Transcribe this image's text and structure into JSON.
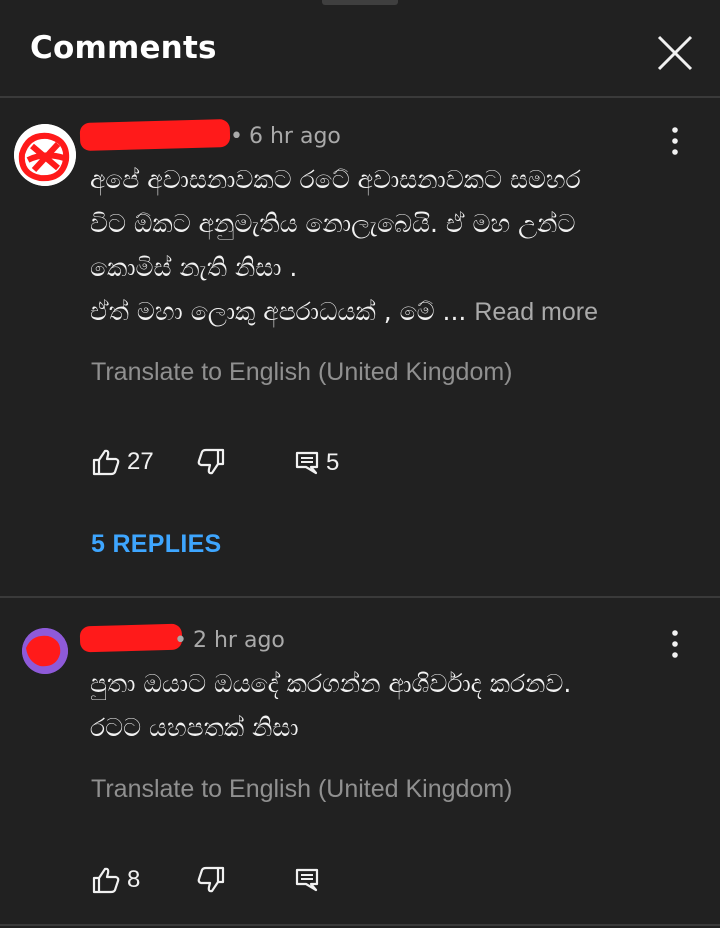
{
  "header": {
    "title": "Comments",
    "close_icon": "close-icon"
  },
  "comments": [
    {
      "time": "6 hr ago",
      "text_lines": [
        "අපේ අවාසනාවකට රටේ අවාසනාවකට සමහර",
        "විට ඕකට අනුමැතිය නොලැබෙයි. ඒ මහ උන්ට",
        "කොමිස් නැති නිසා .",
        "ඒත් මහා ලොකු අපරාධයක් , මේ ..."
      ],
      "read_more": "Read more",
      "translate": "Translate to English (United Kingdom)",
      "likes": "27",
      "reply_count": "5",
      "replies_link": "5 REPLIES"
    },
    {
      "time": "2 hr ago",
      "text_lines": [
        "පුතා ඔයාට ඔයදේ කරගන්න ආශිර්වාද කරනව.",
        "රටට යහපතක් නිසා"
      ],
      "translate": "Translate to English (United Kingdom)",
      "likes": "8"
    }
  ],
  "colors": {
    "background": "#212121",
    "text": "#f1f1f1",
    "secondary": "#aaaaaa",
    "link": "#3ea6ff",
    "redaction": "#ff1a1a"
  }
}
